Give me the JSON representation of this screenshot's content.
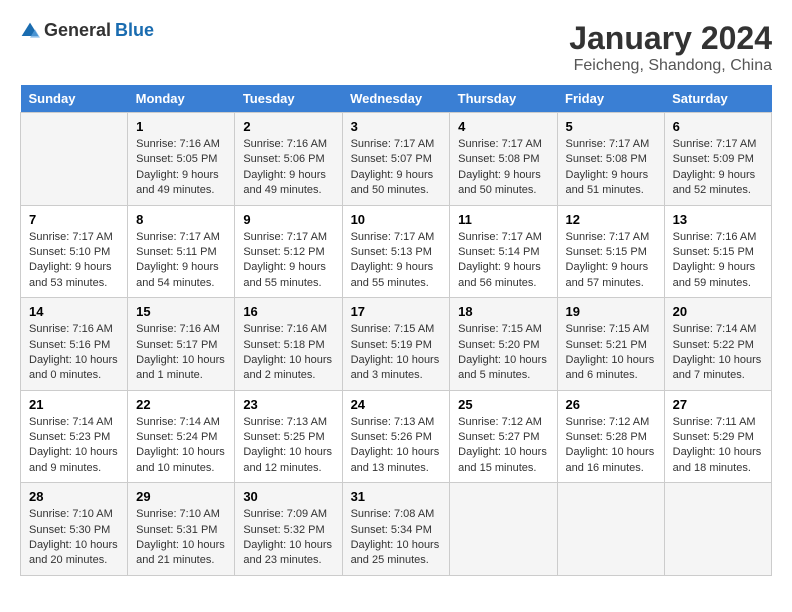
{
  "header": {
    "logo_general": "General",
    "logo_blue": "Blue",
    "month_year": "January 2024",
    "location": "Feicheng, Shandong, China"
  },
  "weekdays": [
    "Sunday",
    "Monday",
    "Tuesday",
    "Wednesday",
    "Thursday",
    "Friday",
    "Saturday"
  ],
  "weeks": [
    [
      {
        "day": "",
        "info": ""
      },
      {
        "day": "1",
        "info": "Sunrise: 7:16 AM\nSunset: 5:05 PM\nDaylight: 9 hours\nand 49 minutes."
      },
      {
        "day": "2",
        "info": "Sunrise: 7:16 AM\nSunset: 5:06 PM\nDaylight: 9 hours\nand 49 minutes."
      },
      {
        "day": "3",
        "info": "Sunrise: 7:17 AM\nSunset: 5:07 PM\nDaylight: 9 hours\nand 50 minutes."
      },
      {
        "day": "4",
        "info": "Sunrise: 7:17 AM\nSunset: 5:08 PM\nDaylight: 9 hours\nand 50 minutes."
      },
      {
        "day": "5",
        "info": "Sunrise: 7:17 AM\nSunset: 5:08 PM\nDaylight: 9 hours\nand 51 minutes."
      },
      {
        "day": "6",
        "info": "Sunrise: 7:17 AM\nSunset: 5:09 PM\nDaylight: 9 hours\nand 52 minutes."
      }
    ],
    [
      {
        "day": "7",
        "info": "Sunrise: 7:17 AM\nSunset: 5:10 PM\nDaylight: 9 hours\nand 53 minutes."
      },
      {
        "day": "8",
        "info": "Sunrise: 7:17 AM\nSunset: 5:11 PM\nDaylight: 9 hours\nand 54 minutes."
      },
      {
        "day": "9",
        "info": "Sunrise: 7:17 AM\nSunset: 5:12 PM\nDaylight: 9 hours\nand 55 minutes."
      },
      {
        "day": "10",
        "info": "Sunrise: 7:17 AM\nSunset: 5:13 PM\nDaylight: 9 hours\nand 55 minutes."
      },
      {
        "day": "11",
        "info": "Sunrise: 7:17 AM\nSunset: 5:14 PM\nDaylight: 9 hours\nand 56 minutes."
      },
      {
        "day": "12",
        "info": "Sunrise: 7:17 AM\nSunset: 5:15 PM\nDaylight: 9 hours\nand 57 minutes."
      },
      {
        "day": "13",
        "info": "Sunrise: 7:16 AM\nSunset: 5:15 PM\nDaylight: 9 hours\nand 59 minutes."
      }
    ],
    [
      {
        "day": "14",
        "info": "Sunrise: 7:16 AM\nSunset: 5:16 PM\nDaylight: 10 hours\nand 0 minutes."
      },
      {
        "day": "15",
        "info": "Sunrise: 7:16 AM\nSunset: 5:17 PM\nDaylight: 10 hours\nand 1 minute."
      },
      {
        "day": "16",
        "info": "Sunrise: 7:16 AM\nSunset: 5:18 PM\nDaylight: 10 hours\nand 2 minutes."
      },
      {
        "day": "17",
        "info": "Sunrise: 7:15 AM\nSunset: 5:19 PM\nDaylight: 10 hours\nand 3 minutes."
      },
      {
        "day": "18",
        "info": "Sunrise: 7:15 AM\nSunset: 5:20 PM\nDaylight: 10 hours\nand 5 minutes."
      },
      {
        "day": "19",
        "info": "Sunrise: 7:15 AM\nSunset: 5:21 PM\nDaylight: 10 hours\nand 6 minutes."
      },
      {
        "day": "20",
        "info": "Sunrise: 7:14 AM\nSunset: 5:22 PM\nDaylight: 10 hours\nand 7 minutes."
      }
    ],
    [
      {
        "day": "21",
        "info": "Sunrise: 7:14 AM\nSunset: 5:23 PM\nDaylight: 10 hours\nand 9 minutes."
      },
      {
        "day": "22",
        "info": "Sunrise: 7:14 AM\nSunset: 5:24 PM\nDaylight: 10 hours\nand 10 minutes."
      },
      {
        "day": "23",
        "info": "Sunrise: 7:13 AM\nSunset: 5:25 PM\nDaylight: 10 hours\nand 12 minutes."
      },
      {
        "day": "24",
        "info": "Sunrise: 7:13 AM\nSunset: 5:26 PM\nDaylight: 10 hours\nand 13 minutes."
      },
      {
        "day": "25",
        "info": "Sunrise: 7:12 AM\nSunset: 5:27 PM\nDaylight: 10 hours\nand 15 minutes."
      },
      {
        "day": "26",
        "info": "Sunrise: 7:12 AM\nSunset: 5:28 PM\nDaylight: 10 hours\nand 16 minutes."
      },
      {
        "day": "27",
        "info": "Sunrise: 7:11 AM\nSunset: 5:29 PM\nDaylight: 10 hours\nand 18 minutes."
      }
    ],
    [
      {
        "day": "28",
        "info": "Sunrise: 7:10 AM\nSunset: 5:30 PM\nDaylight: 10 hours\nand 20 minutes."
      },
      {
        "day": "29",
        "info": "Sunrise: 7:10 AM\nSunset: 5:31 PM\nDaylight: 10 hours\nand 21 minutes."
      },
      {
        "day": "30",
        "info": "Sunrise: 7:09 AM\nSunset: 5:32 PM\nDaylight: 10 hours\nand 23 minutes."
      },
      {
        "day": "31",
        "info": "Sunrise: 7:08 AM\nSunset: 5:34 PM\nDaylight: 10 hours\nand 25 minutes."
      },
      {
        "day": "",
        "info": ""
      },
      {
        "day": "",
        "info": ""
      },
      {
        "day": "",
        "info": ""
      }
    ]
  ]
}
